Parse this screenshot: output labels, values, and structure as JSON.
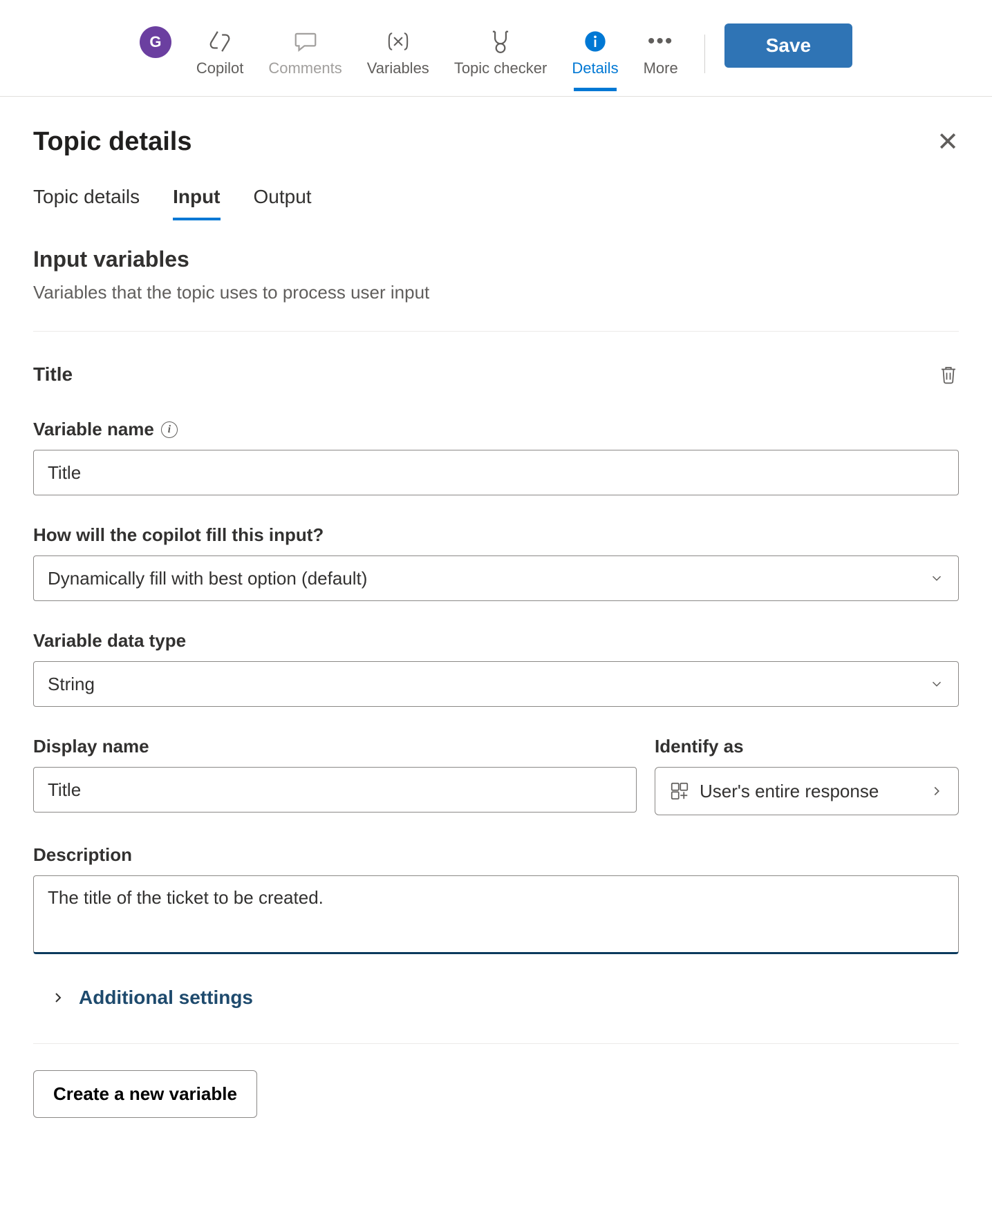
{
  "avatar_initial": "G",
  "toolbar": {
    "copilot": "Copilot",
    "comments": "Comments",
    "variables": "Variables",
    "topic_checker": "Topic checker",
    "details": "Details",
    "more": "More",
    "save": "Save"
  },
  "panel": {
    "title": "Topic details"
  },
  "tabs": {
    "topic_details": "Topic details",
    "input": "Input",
    "output": "Output"
  },
  "section": {
    "heading": "Input variables",
    "sub": "Variables that the topic uses to process user input"
  },
  "variable": {
    "title": "Title",
    "labels": {
      "variable_name": "Variable name",
      "fill_mode": "How will the copilot fill this input?",
      "data_type": "Variable data type",
      "display_name": "Display name",
      "identify_as": "Identify as",
      "description": "Description"
    },
    "values": {
      "variable_name": "Title",
      "fill_mode": "Dynamically fill with best option (default)",
      "data_type": "String",
      "display_name": "Title",
      "identify_as": "User's entire response",
      "description": "The title of the ticket to be created."
    }
  },
  "additional_settings": "Additional settings",
  "create_new_variable": "Create a new variable"
}
